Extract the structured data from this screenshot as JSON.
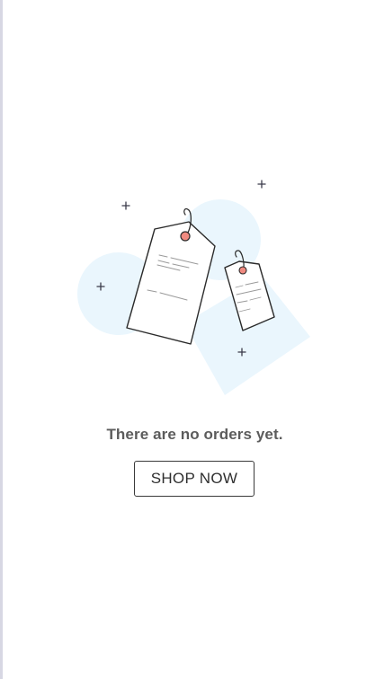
{
  "empty_state": {
    "message": "There are no orders yet.",
    "button_label": "SHOP NOW",
    "illustration_icon": "price-tags-icon"
  },
  "colors": {
    "accent_blob": "#eaf6fd",
    "tag_hole": "#f08a80",
    "outline": "#2b2b2b",
    "message_text": "#5c5c5c",
    "button_border": "#3a3a3a"
  }
}
